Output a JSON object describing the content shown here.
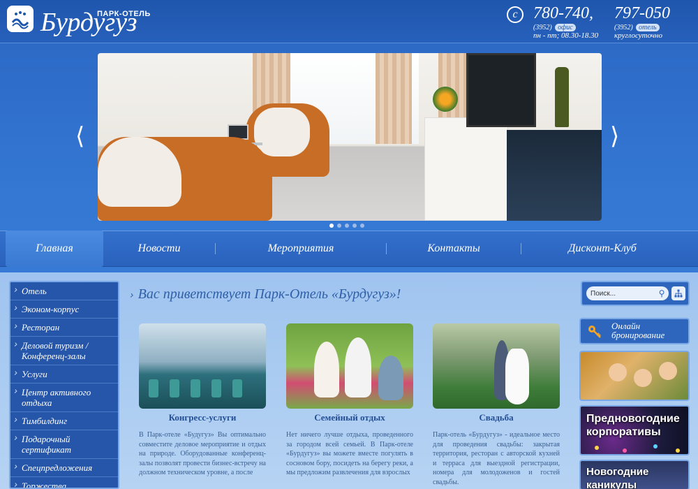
{
  "header": {
    "logo_sub": "ПАРК-ОТЕЛЬ",
    "logo_name": "Бурдугуз",
    "phone_icon": "phone-icon",
    "phones": [
      {
        "number": "780-740,",
        "code": "(3952)",
        "tag": "офис",
        "hours": "пн - пт; 08.30-18.30"
      },
      {
        "number": "797-050",
        "code": "(3952)",
        "tag": "отель",
        "hours": "круглосуточно"
      }
    ]
  },
  "slider": {
    "prev_icon": "chevron-left-icon",
    "next_icon": "chevron-right-icon",
    "slide_count": 5,
    "active_slide": 1
  },
  "nav": {
    "items": [
      {
        "label": "Главная",
        "active": true
      },
      {
        "label": "Новости",
        "active": false
      },
      {
        "label": "Мероприятия",
        "active": false
      },
      {
        "label": "Контакты",
        "active": false
      },
      {
        "label": "Дисконт-Клуб",
        "active": false
      }
    ]
  },
  "sidebar": {
    "items": [
      {
        "label": "Отель"
      },
      {
        "label": "Эконом-корпус"
      },
      {
        "label": "Ресторан"
      },
      {
        "label": "Деловой туризм / Конференц-залы"
      },
      {
        "label": "Услуги"
      },
      {
        "label": "Центр активного отдыха"
      },
      {
        "label": "Тимбилдинг"
      },
      {
        "label": "Подарочный сертификат"
      },
      {
        "label": "Спецпредложения"
      },
      {
        "label": "Торжества"
      }
    ]
  },
  "main": {
    "welcome": "Вас приветствует Парк-Отель «Бурдугуз»!",
    "cards": [
      {
        "title": "Конгресс-услуги",
        "text": "В Парк-отеле «Будугуз» Вы оптимально совместите деловое мероприятие и отдых на природе. Оборудованные конференц-залы позволят провести бизнес-встречу на должном техническом уровне, а после"
      },
      {
        "title": "Семейный отдых",
        "text": "Нет ничего лучше отдыха, проведенного за городом всей семьей. В Парк-отеле «Бурдугуз» вы можете вместе погулять в сосновом бору, посидеть на берегу реки, а мы предложим развлечения для взрослых"
      },
      {
        "title": "Свадьба",
        "text": "Парк-отель «Бурдугуз» - идеальное место для проведения свадьбы: закрытая территория, ресторан с авторской кухней и терраса для выездной регистрации, номера для молодоженов и гостей свадьбы."
      }
    ]
  },
  "right": {
    "search_placeholder": "Поиск...",
    "search_icon": "search-icon",
    "sitemap_icon": "sitemap-icon",
    "booking_line1": "Онлайн",
    "booking_line2": "бронирование",
    "booking_icon": "key-icon",
    "banners": [
      {
        "text_line1": "",
        "text_line2": ""
      },
      {
        "text_line1": "Предновогодние",
        "text_line2": "корпоративы"
      },
      {
        "text_line1": "Новогодние",
        "text_line2": "каникулы"
      }
    ]
  }
}
